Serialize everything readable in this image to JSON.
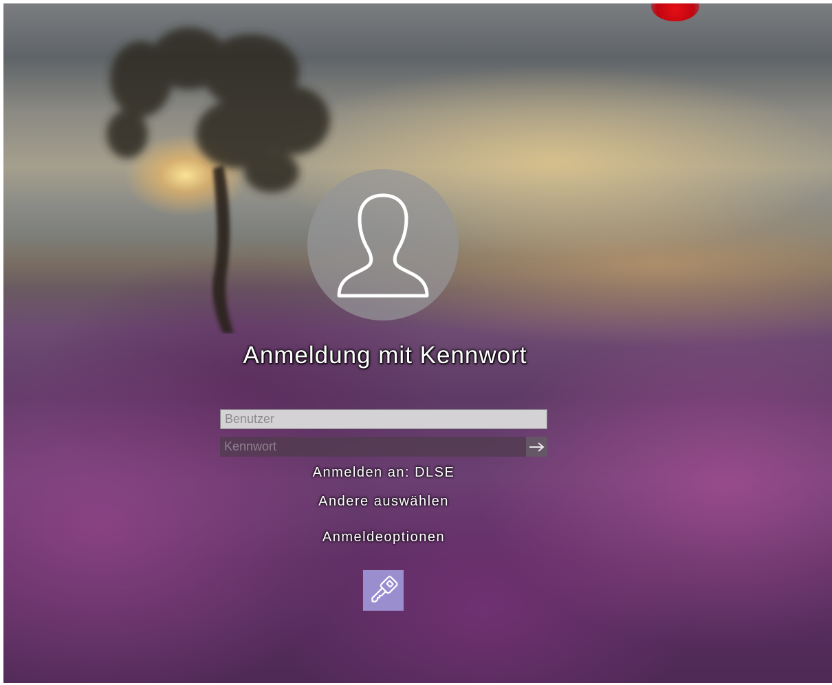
{
  "login": {
    "title": "Anmeldung mit Kennwort",
    "username_placeholder": "Benutzer",
    "password_placeholder": "Kennwort",
    "domain_text": "Anmelden an: DLSE",
    "switch_user_label": "Andere auswählen",
    "sign_in_options_label": "Anmeldeoptionen"
  },
  "icons": {
    "avatar": "user-silhouette-icon",
    "submit": "arrow-right-icon",
    "password_option": "key-icon"
  },
  "colors": {
    "key_tile": "#9a8ecf",
    "username_field": "#d5d2d6",
    "indicator_red": "#e50f16"
  }
}
